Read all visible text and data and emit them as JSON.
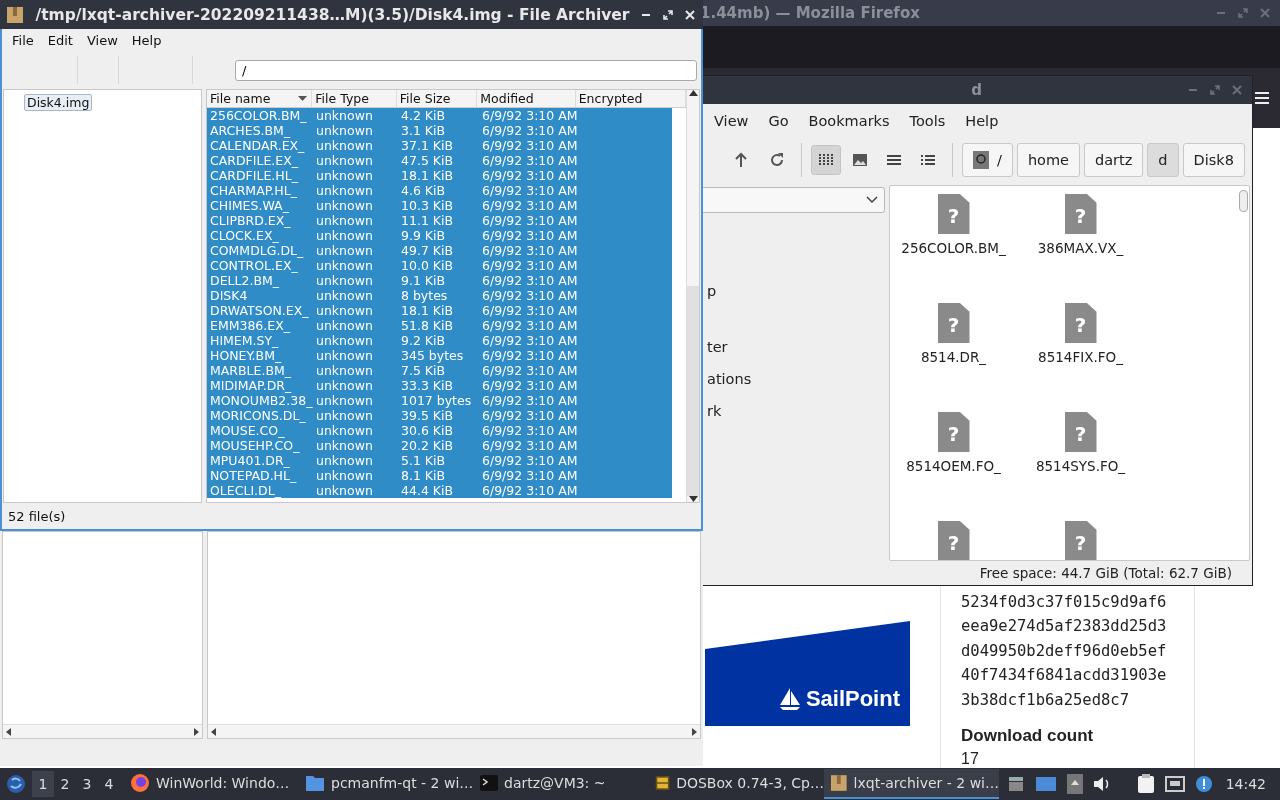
{
  "firefox_window": {
    "title": "1.44mb) — Mozilla Firefox",
    "ad_logo": "SailPoint",
    "hash_lines": [
      "5234f0d3c37f015c9d9af6",
      "eea9e274d5af2383dd25d3",
      "d049950b2deff96d0eb5ef",
      "40f7434f6841acdd31903e",
      "3b38dcf1b6a25ed8c7"
    ],
    "download_count_label": "Download count",
    "download_count": "17"
  },
  "file_manager": {
    "title": "d",
    "menu": [
      "View",
      "Go",
      "Bookmarks",
      "Tools",
      "Help"
    ],
    "view_modes": [
      {
        "kind": "icons",
        "selected": true
      },
      {
        "kind": "thumbnails",
        "selected": false
      },
      {
        "kind": "compact",
        "selected": false
      },
      {
        "kind": "details",
        "selected": false
      }
    ],
    "path": [
      {
        "kind": "drive",
        "label": "/",
        "selected": false
      },
      {
        "kind": "folder",
        "label": "home",
        "selected": false
      },
      {
        "kind": "folder",
        "label": "dartz",
        "selected": false
      },
      {
        "kind": "folder",
        "label": "d",
        "selected": true
      },
      {
        "kind": "folder",
        "label": "Disk8",
        "selected": false
      }
    ],
    "side_items": [
      "p",
      "ter",
      "ations",
      "rk"
    ],
    "files": [
      {
        "kind": "file",
        "icon_glyph": "?",
        "label": "256COLOR.BM_"
      },
      {
        "kind": "file",
        "icon_glyph": "?",
        "label": "386MAX.VX_"
      },
      {
        "kind": "file",
        "icon_glyph": "?",
        "label": "8514.DR_"
      },
      {
        "kind": "file",
        "icon_glyph": "?",
        "label": "8514FIX.FO_"
      },
      {
        "kind": "file",
        "icon_glyph": "?",
        "label": "8514OEM.FO_"
      },
      {
        "kind": "file",
        "icon_glyph": "?",
        "label": "8514SYS.FO_"
      },
      {
        "kind": "partial",
        "icon_glyph": "?"
      },
      {
        "kind": "partial",
        "icon_glyph": "?"
      }
    ],
    "status": "Free space: 44.7 GiB (Total: 62.7 GiB)"
  },
  "archiver": {
    "title": "/tmp/lxqt-archiver-202209211438…M)(3.5)/Disk4.img - File Archiver",
    "menu": [
      "File",
      "Edit",
      "View",
      "Help"
    ],
    "location": "/",
    "tree": [
      {
        "label": "Disk4.img",
        "selected": true
      }
    ],
    "table": {
      "columns": [
        {
          "label": "File name",
          "sorted": true
        },
        {
          "label": "File Type",
          "sorted": false
        },
        {
          "label": "File Size",
          "sorted": false
        },
        {
          "label": "Modified",
          "sorted": false
        },
        {
          "label": "Encrypted",
          "sorted": false
        }
      ],
      "rows": [
        {
          "cells": [
            "256COLOR.BM_",
            "unknown",
            "4.2 KiB",
            "6/9/92 3:10 AM"
          ],
          "selected": true
        },
        {
          "cells": [
            "ARCHES.BM_",
            "unknown",
            "3.1 KiB",
            "6/9/92 3:10 AM"
          ],
          "selected": true
        },
        {
          "cells": [
            "CALENDAR.EX_",
            "unknown",
            "37.1 KiB",
            "6/9/92 3:10 AM"
          ],
          "selected": true
        },
        {
          "cells": [
            "CARDFILE.EX_",
            "unknown",
            "47.5 KiB",
            "6/9/92 3:10 AM"
          ],
          "selected": true
        },
        {
          "cells": [
            "CARDFILE.HL_",
            "unknown",
            "18.1 KiB",
            "6/9/92 3:10 AM"
          ],
          "selected": true
        },
        {
          "cells": [
            "CHARMAP.HL_",
            "unknown",
            "4.6 KiB",
            "6/9/92 3:10 AM"
          ],
          "selected": true
        },
        {
          "cells": [
            "CHIMES.WA_",
            "unknown",
            "10.3 KiB",
            "6/9/92 3:10 AM"
          ],
          "selected": true
        },
        {
          "cells": [
            "CLIPBRD.EX_",
            "unknown",
            "11.1 KiB",
            "6/9/92 3:10 AM"
          ],
          "selected": true
        },
        {
          "cells": [
            "CLOCK.EX_",
            "unknown",
            "9.9 KiB",
            "6/9/92 3:10 AM"
          ],
          "selected": true
        },
        {
          "cells": [
            "COMMDLG.DL_",
            "unknown",
            "49.7 KiB",
            "6/9/92 3:10 AM"
          ],
          "selected": true
        },
        {
          "cells": [
            "CONTROL.EX_",
            "unknown",
            "10.0 KiB",
            "6/9/92 3:10 AM"
          ],
          "selected": true
        },
        {
          "cells": [
            "DELL2.BM_",
            "unknown",
            "9.1 KiB",
            "6/9/92 3:10 AM"
          ],
          "selected": true
        },
        {
          "cells": [
            "DISK4",
            "unknown",
            "8 bytes",
            "6/9/92 3:10 AM"
          ],
          "selected": true
        },
        {
          "cells": [
            "DRWATSON.EX_",
            "unknown",
            "18.1 KiB",
            "6/9/92 3:10 AM"
          ],
          "selected": true
        },
        {
          "cells": [
            "EMM386.EX_",
            "unknown",
            "51.8 KiB",
            "6/9/92 3:10 AM"
          ],
          "selected": true
        },
        {
          "cells": [
            "HIMEM.SY_",
            "unknown",
            "9.2 KiB",
            "6/9/92 3:10 AM"
          ],
          "selected": true
        },
        {
          "cells": [
            "HONEY.BM_",
            "unknown",
            "345 bytes",
            "6/9/92 3:10 AM"
          ],
          "selected": true
        },
        {
          "cells": [
            "MARBLE.BM_",
            "unknown",
            "7.5 KiB",
            "6/9/92 3:10 AM"
          ],
          "selected": true
        },
        {
          "cells": [
            "MIDIMAP.DR_",
            "unknown",
            "33.3 KiB",
            "6/9/92 3:10 AM"
          ],
          "selected": true
        },
        {
          "cells": [
            "MONOUMB2.38_",
            "unknown",
            "1017 bytes",
            "6/9/92 3:10 AM"
          ],
          "selected": true
        },
        {
          "cells": [
            "MORICONS.DL_",
            "unknown",
            "39.5 KiB",
            "6/9/92 3:10 AM"
          ],
          "selected": true
        },
        {
          "cells": [
            "MOUSE.CO_",
            "unknown",
            "30.6 KiB",
            "6/9/92 3:10 AM"
          ],
          "selected": true
        },
        {
          "cells": [
            "MOUSEHP.CO_",
            "unknown",
            "20.2 KiB",
            "6/9/92 3:10 AM"
          ],
          "selected": true
        },
        {
          "cells": [
            "MPU401.DR_",
            "unknown",
            "5.1 KiB",
            "6/9/92 3:10 AM"
          ],
          "selected": true
        },
        {
          "cells": [
            "NOTEPAD.HL_",
            "unknown",
            "8.1 KiB",
            "6/9/92 3:10 AM"
          ],
          "selected": true
        },
        {
          "cells": [
            "OLECLI.DL_",
            "unknown",
            "44.4 KiB",
            "6/9/92 3:10 AM"
          ],
          "selected": true
        }
      ]
    },
    "status": "52 file(s)"
  },
  "taskbar": {
    "desktops": [
      {
        "label": "1",
        "selected": true
      },
      {
        "label": "2",
        "selected": false
      },
      {
        "label": "3",
        "selected": false
      },
      {
        "label": "4",
        "selected": false
      }
    ],
    "tasks": [
      {
        "kind": "firefox",
        "label": "WinWorld: Windo…",
        "selected": false
      },
      {
        "kind": "folder",
        "label": "pcmanfm-qt - 2 wi…",
        "selected": false
      },
      {
        "kind": "terminal",
        "label": "dartz@VM3: ~",
        "selected": false
      },
      {
        "kind": "dosbox",
        "label": "DOSBox 0.74-3, Cp…",
        "selected": false
      },
      {
        "kind": "archive",
        "label": "lxqt-archiver - 2 wi…",
        "selected": true
      }
    ],
    "clock": "14:42"
  }
}
